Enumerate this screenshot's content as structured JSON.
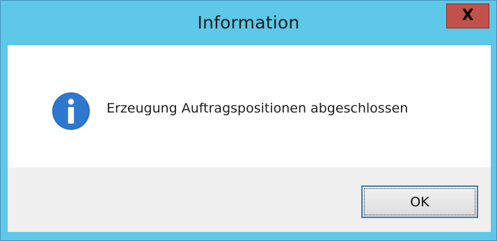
{
  "window": {
    "title": "Information",
    "close_label": "X",
    "title_bar_color": "#5ec8e8",
    "close_button_color": "#c0524b"
  },
  "dialog": {
    "icon": "info-icon",
    "icon_color": "#2a6fc6",
    "message": "Erzeugung Auftragspositionen abgeschlossen"
  },
  "buttons": {
    "ok_label": "OK"
  }
}
